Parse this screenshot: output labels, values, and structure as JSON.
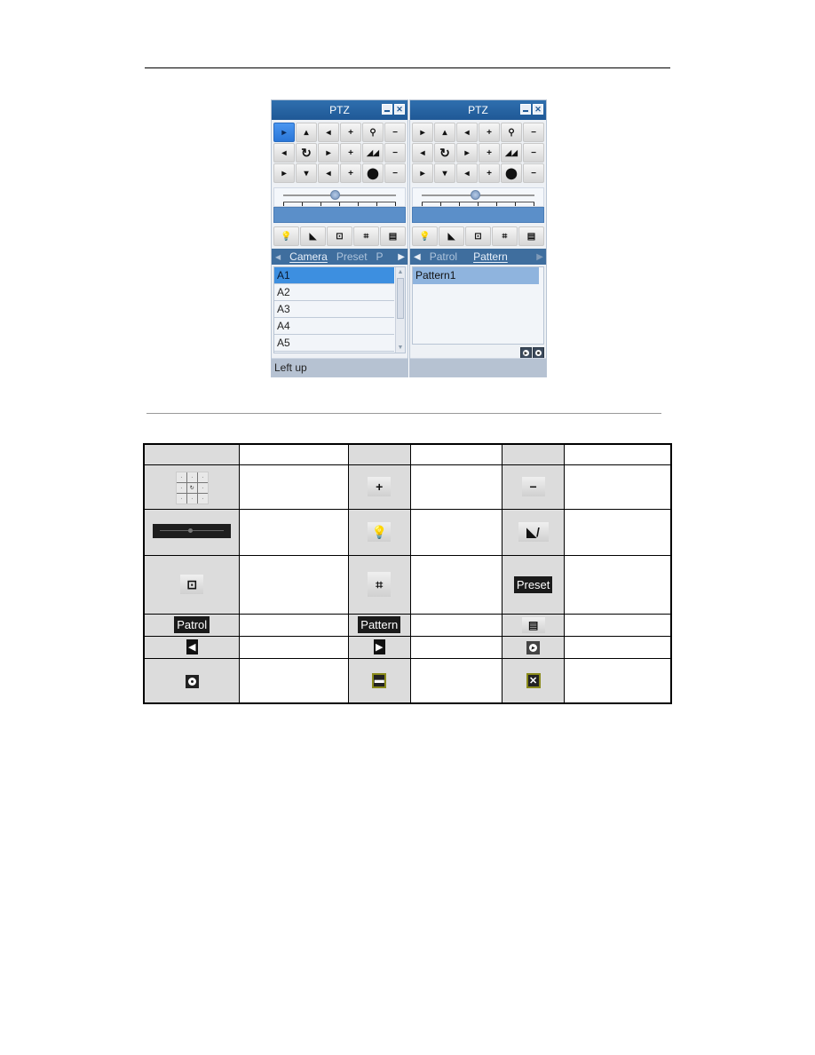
{
  "left_panel": {
    "title": "PTZ",
    "pad": [
      "▸",
      "▴",
      "◂",
      "+",
      "🔍",
      "−",
      "◂",
      "↻",
      "▸",
      "+",
      "◢",
      "−",
      "▸",
      "▾",
      "◂",
      "+",
      "●",
      "−"
    ],
    "speed_label": "",
    "function_buttons": [
      "light-icon",
      "wiper-icon",
      "zoom-area-icon",
      "center-icon",
      "menu-icon"
    ],
    "tabs": [
      {
        "label": "Camera",
        "active": true
      },
      {
        "label": "Preset",
        "active": false
      },
      {
        "label": "P",
        "active": false
      }
    ],
    "list": [
      "A1",
      "A2",
      "A3",
      "A4",
      "A5"
    ],
    "selected": "A1",
    "status": "Left up"
  },
  "right_panel": {
    "title": "PTZ",
    "tabs": [
      {
        "label": "Patrol",
        "active": false
      },
      {
        "label": "Pattern",
        "active": true
      }
    ],
    "list": [
      "Pattern1"
    ],
    "selected": "Pattern1",
    "status": ""
  },
  "legend_table": {
    "header": [
      "",
      "",
      "",
      "",
      "",
      ""
    ],
    "rows": [
      {
        "icons": [
          "direction-pad-icon",
          "plus-icon",
          "minus-icon"
        ],
        "descriptions": [
          "",
          "",
          ""
        ]
      },
      {
        "icons": [
          "speed-slider-icon",
          "light-icon",
          "wiper-icon"
        ],
        "descriptions": [
          "",
          "",
          ""
        ]
      },
      {
        "icons": [
          "3d-zoom-icon",
          "image-center-icon",
          "preset-label"
        ],
        "descriptions": [
          "",
          "",
          ""
        ]
      },
      {
        "icons": [
          "patrol-label",
          "pattern-label",
          "menu-icon"
        ],
        "descriptions": [
          "",
          "",
          ""
        ]
      },
      {
        "icons": [
          "previous-item-icon",
          "next-item-icon",
          "start-pattern-icon"
        ],
        "descriptions": [
          "",
          "",
          ""
        ]
      },
      {
        "icons": [
          "stop-pattern-icon",
          "minimize-icon",
          "close-icon"
        ],
        "descriptions": [
          "",
          "",
          ""
        ]
      }
    ],
    "labels": {
      "preset": "Preset",
      "patrol": "Patrol",
      "pattern": "Pattern"
    }
  }
}
